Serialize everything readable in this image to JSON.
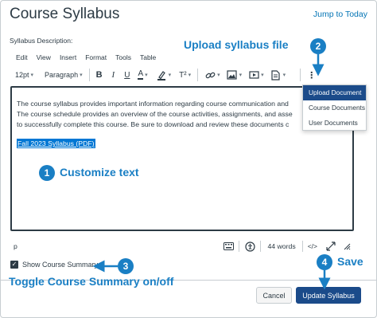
{
  "page": {
    "title": "Course Syllabus",
    "jump_link": "Jump to Today",
    "description_label": "Syllabus Description:"
  },
  "menubar": [
    "Edit",
    "View",
    "Insert",
    "Format",
    "Tools",
    "Table"
  ],
  "toolbar": {
    "font_size": "12pt",
    "block_format": "Paragraph",
    "bold": "B",
    "italic": "I",
    "underline": "U",
    "text_color": "A",
    "superscript": "T²",
    "icons": [
      "bold-icon",
      "italic-icon",
      "underline-icon",
      "text-color-icon",
      "highlight-icon",
      "superscript-icon",
      "link-icon",
      "image-icon",
      "media-icon",
      "document-icon",
      "more-icon"
    ]
  },
  "editor": {
    "line1": "The course syllabus provides important information regarding course communication and",
    "line2": "The course schedule provides an overview of the course activities, assignments, and asse",
    "line3": "to successfully complete this course. Be sure to download and review these documents c",
    "link": "Fall 2023 Syllabus (PDF)"
  },
  "document_menu": {
    "items": [
      "Upload Document",
      "Course Documents",
      "User Documents"
    ],
    "active_index": 0
  },
  "statusbar": {
    "path": "p",
    "word_count": "44 words",
    "html_toggle": "</>"
  },
  "summary": {
    "label": "Show Course Summary",
    "checked": true
  },
  "buttons": {
    "cancel": "Cancel",
    "update": "Update Syllabus"
  },
  "annotations": {
    "a1": {
      "number": "1",
      "text": "Customize text"
    },
    "a2": {
      "number": "2",
      "text": "Upload syllabus file"
    },
    "a3": {
      "number": "3",
      "text": "Toggle Course Summary on/off"
    },
    "a4": {
      "number": "4",
      "text": "Save"
    }
  },
  "colors": {
    "annotation": "#1a7fc4",
    "primary_button": "#1b4b8a",
    "link": "#0374b5",
    "selection": "#0077d4"
  }
}
